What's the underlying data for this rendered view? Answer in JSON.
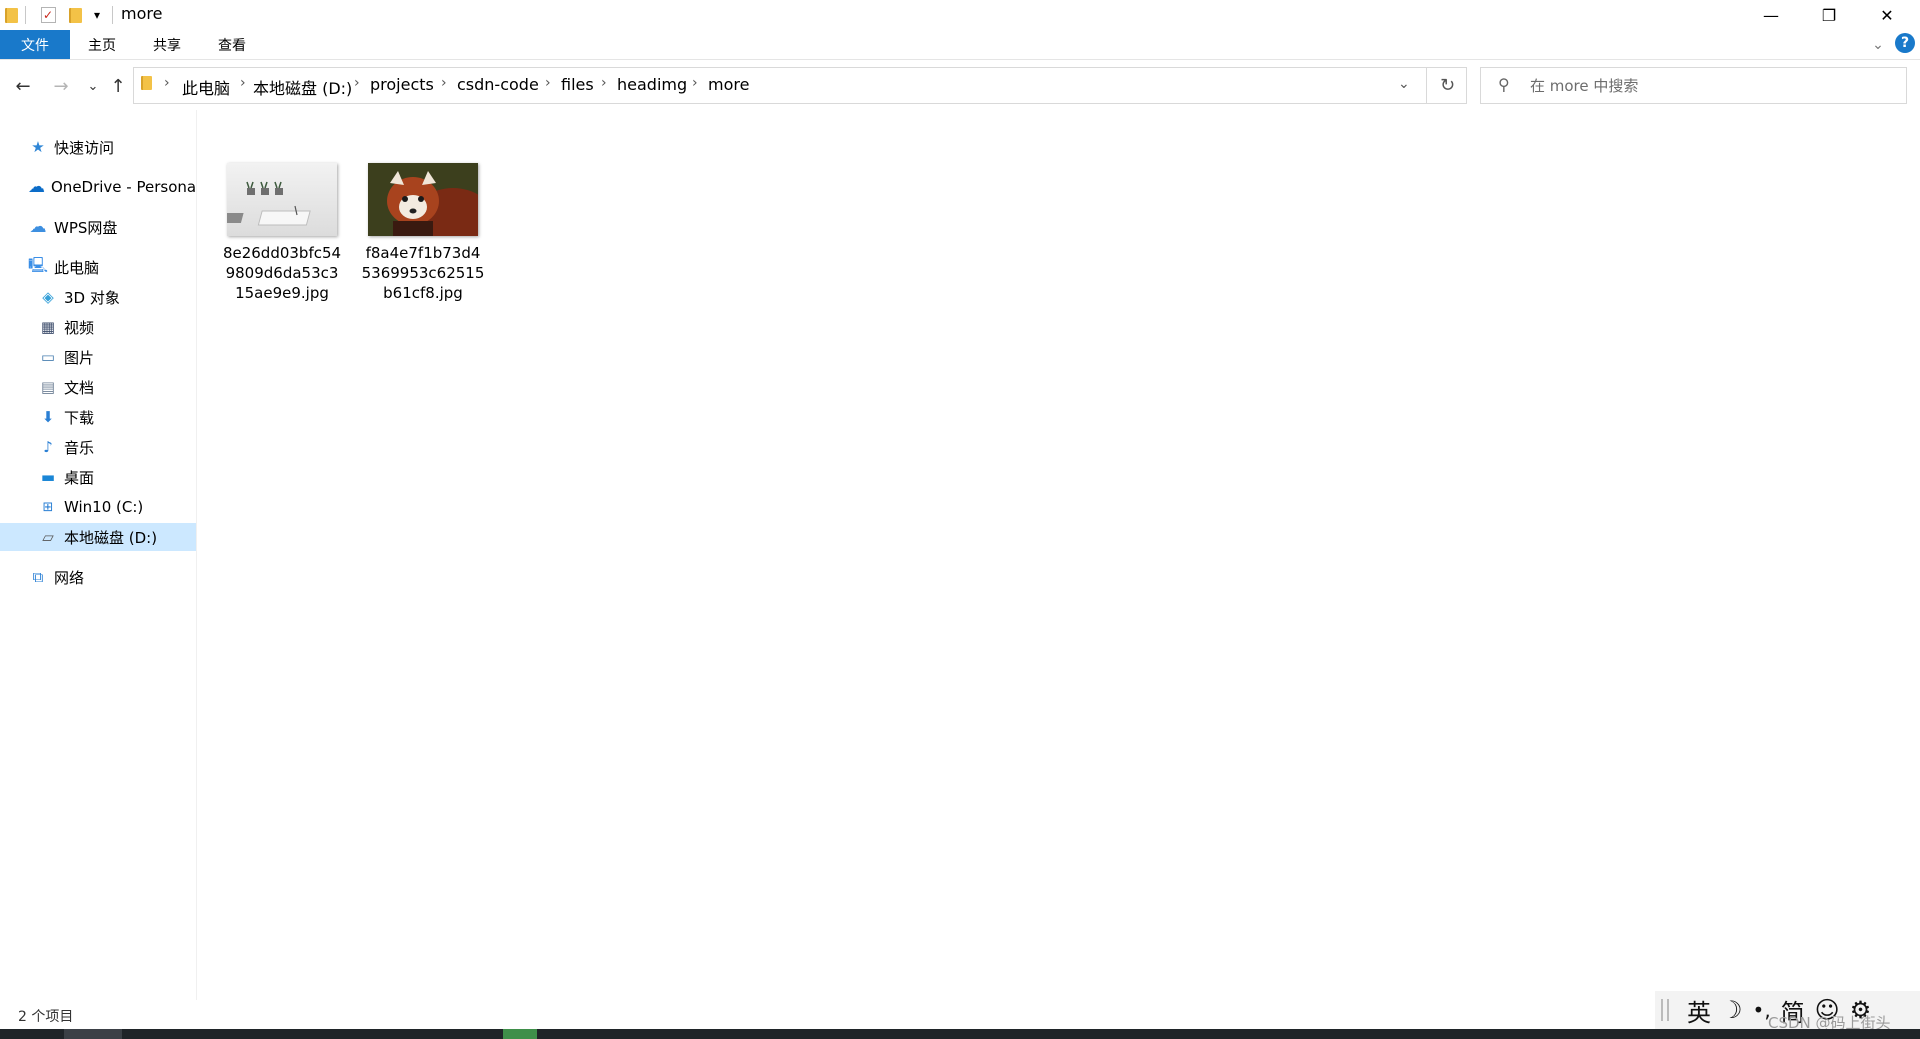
{
  "window": {
    "title": "more",
    "minimize_glyph": "—",
    "maximize_glyph": "❐",
    "close_glyph": "✕",
    "quick_access_dropdown": "▾"
  },
  "ribbon": {
    "tabs": [
      "文件",
      "主页",
      "共享",
      "查看"
    ],
    "collapse_glyph": "⌄",
    "help_glyph": "?"
  },
  "nav": {
    "back": "←",
    "forward": "→",
    "recent": "⌄",
    "up": "↑",
    "breadcrumb": [
      "此电脑",
      "本地磁盘 (D:)",
      "projects",
      "csdn-code",
      "files",
      "headimg",
      "more"
    ],
    "crumb_separator": "›",
    "address_dropdown": "⌄",
    "refresh": "↻",
    "search_placeholder": "在 more 中搜索",
    "search_icon": "⚲"
  },
  "sidebar": {
    "items": [
      {
        "label": "快速访问",
        "icon": "star-icon"
      },
      {
        "label": "OneDrive - Persona",
        "icon": "onedrive-cloud-icon"
      },
      {
        "label": "WPS网盘",
        "icon": "wps-cloud-icon"
      },
      {
        "label": "此电脑",
        "icon": "computer-icon"
      },
      {
        "label": "3D 对象",
        "icon": "cube-icon"
      },
      {
        "label": "视频",
        "icon": "video-icon"
      },
      {
        "label": "图片",
        "icon": "pictures-icon"
      },
      {
        "label": "文档",
        "icon": "documents-icon"
      },
      {
        "label": "下载",
        "icon": "download-arrow-icon"
      },
      {
        "label": "音乐",
        "icon": "music-note-icon"
      },
      {
        "label": "桌面",
        "icon": "desktop-icon"
      },
      {
        "label": "Win10 (C:)",
        "icon": "windows-drive-icon"
      },
      {
        "label": "本地磁盘 (D:)",
        "icon": "drive-icon"
      },
      {
        "label": "网络",
        "icon": "network-icon"
      }
    ],
    "selected_index": 12
  },
  "files": [
    {
      "name": "8e26dd03bfc549809d6da53c315ae9e9.jpg",
      "lines": [
        "8e26dd03bfc54",
        "9809d6da53c3",
        "15ae9e9.jpg"
      ]
    },
    {
      "name": "f8a4e7f1b73d45369953c62515b61cf8.jpg",
      "lines": [
        "f8a4e7f1b73d4",
        "5369953c62515",
        "b61cf8.jpg"
      ]
    }
  ],
  "status": {
    "item_count": "2 个项目"
  },
  "ime": {
    "glyphs": [
      "英",
      "☽",
      "•,",
      "简",
      "☺",
      "⚙"
    ]
  },
  "watermark": "CSDN @码上街头"
}
